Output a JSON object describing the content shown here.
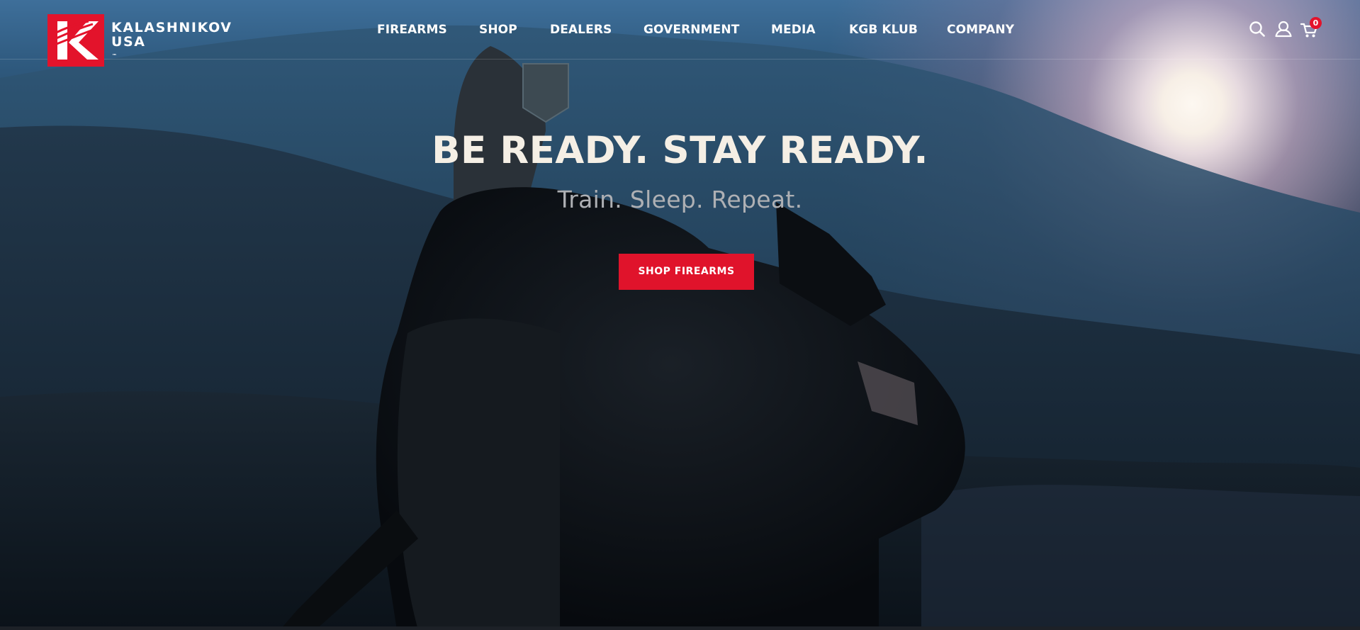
{
  "brand": {
    "name": "KALASHNIKOV",
    "sub": "USA",
    "trademark": "™",
    "logo_letter": "K",
    "color": "#e3132b"
  },
  "nav": {
    "items": [
      {
        "label": "FIREARMS"
      },
      {
        "label": "SHOP"
      },
      {
        "label": "DEALERS"
      },
      {
        "label": "GOVERNMENT"
      },
      {
        "label": "MEDIA"
      },
      {
        "label": "KGB KLUB"
      },
      {
        "label": "COMPANY"
      }
    ]
  },
  "header_icons": {
    "search": "search-icon",
    "account": "user-icon",
    "cart": "cart-icon",
    "cart_count": "0"
  },
  "hero": {
    "headline": "BE READY. STAY READY.",
    "subheadline": "Train. Sleep. Repeat.",
    "cta_label": "SHOP FIREARMS",
    "cta_color": "#e0132b"
  }
}
